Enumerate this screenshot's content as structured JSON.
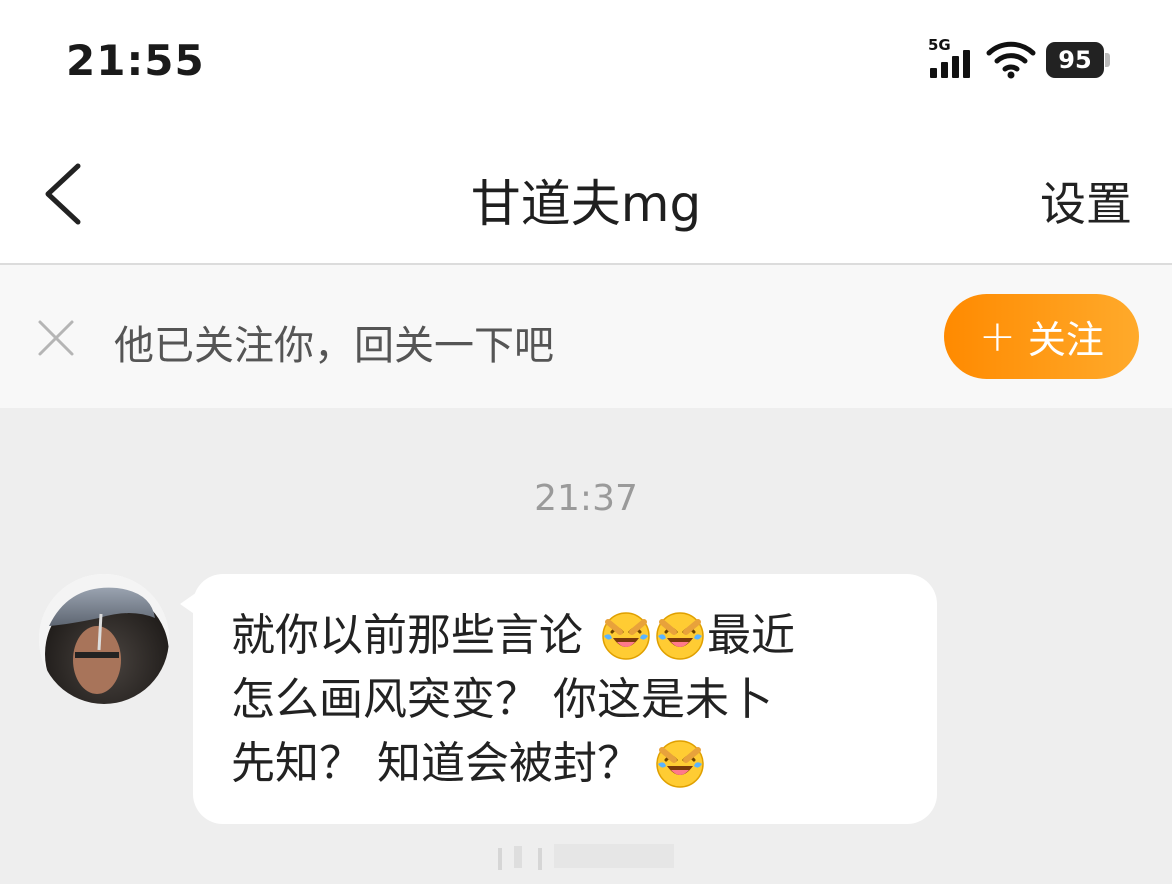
{
  "status_bar": {
    "time": "21:55",
    "network": "5G",
    "battery": "95"
  },
  "nav": {
    "title": "甘道夫mg",
    "settings_label": "设置"
  },
  "follow_banner": {
    "text": "他已关注你，回关一下吧",
    "button_label": "关注",
    "button_plus": "+"
  },
  "chat": {
    "timestamp": "21:37",
    "message": {
      "line1_a": "就你以前那些言论",
      "line1_b": "最近",
      "line2": "怎么画风突变？ 你这是未卜",
      "line3": "先知？ 知道会被封？",
      "emoji": "laughing-crying-emoji"
    }
  },
  "colors": {
    "accent": "#ff9500",
    "page_bg": "#eeeeee",
    "banner_bg": "#f8f8f8"
  }
}
